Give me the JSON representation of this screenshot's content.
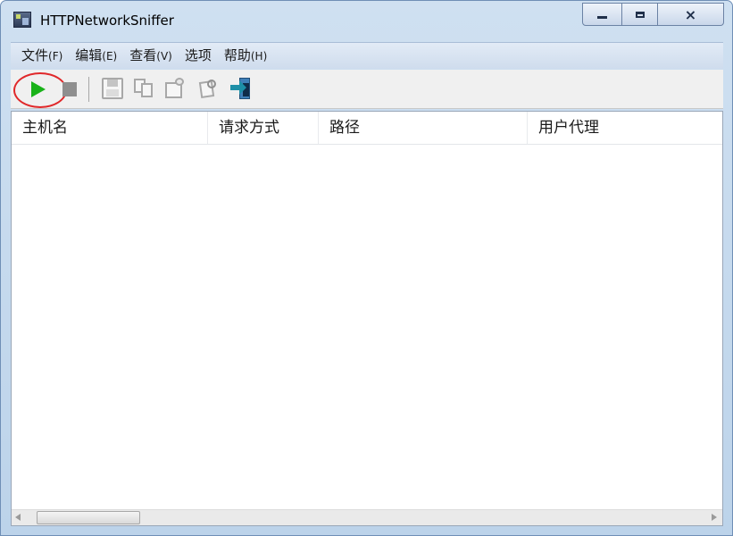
{
  "window": {
    "title": "HTTPNetworkSniffer",
    "icon": "app-icon",
    "controls": {
      "minimize": "minimize-icon",
      "maximize": "maximize-icon",
      "close": "×"
    }
  },
  "menu": [
    {
      "label": "文件",
      "accel": "(F)"
    },
    {
      "label": "编辑",
      "accel": "(E)"
    },
    {
      "label": "查看",
      "accel": "(V)"
    },
    {
      "label": "选项",
      "accel": ""
    },
    {
      "label": "帮助",
      "accel": "(H)"
    }
  ],
  "toolbar": {
    "buttons": [
      {
        "icon": "play-icon",
        "enabled": true
      },
      {
        "icon": "stop-icon",
        "enabled": false
      },
      {
        "icon": "save-icon",
        "enabled": false
      },
      {
        "icon": "copy-icon",
        "enabled": false
      },
      {
        "icon": "properties-icon",
        "enabled": false
      },
      {
        "icon": "find-icon",
        "enabled": false
      },
      {
        "icon": "exit-icon",
        "enabled": true
      }
    ],
    "highlight_color": "#e0282a"
  },
  "list": {
    "columns": [
      "主机名",
      "请求方式",
      "路径",
      "用户代理"
    ],
    "rows": []
  }
}
